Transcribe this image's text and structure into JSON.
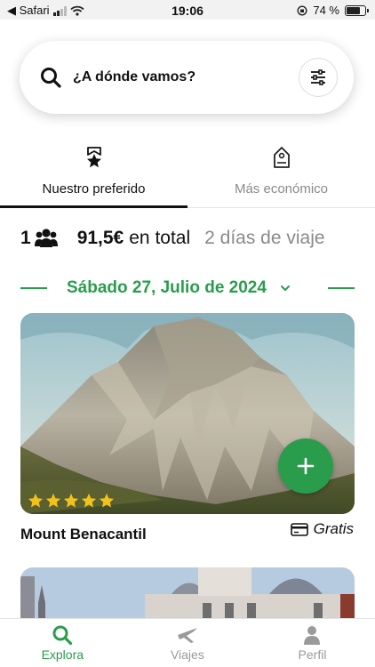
{
  "status_bar": {
    "back_label": "◀ Safari",
    "time": "19:06",
    "battery": "74 %",
    "battery_level": 0.74
  },
  "search": {
    "placeholder": "¿A dónde vamos?"
  },
  "tabs": [
    {
      "label": "Nuestro preferido",
      "icon": "star-ribbon-icon",
      "active": true
    },
    {
      "label": "Más económico",
      "icon": "price-tag-icon",
      "active": false
    }
  ],
  "summary": {
    "people": "1",
    "price": "91,5€",
    "price_suffix": "en total",
    "duration": "2 días de viaje"
  },
  "date": {
    "label": "Sábado 27, Julio de 2024"
  },
  "cards": [
    {
      "title": "Mount Benacantil",
      "price": "Gratis",
      "rating": 5
    }
  ],
  "bottom_nav": [
    {
      "label": "Explora",
      "icon": "search-icon",
      "active": true
    },
    {
      "label": "Viajes",
      "icon": "airplane-icon",
      "active": false
    },
    {
      "label": "Perfil",
      "icon": "person-icon",
      "active": false
    }
  ],
  "colors": {
    "accent": "#2a9d4c",
    "inactive": "#9a9a9a",
    "star": "#f2c21b"
  }
}
